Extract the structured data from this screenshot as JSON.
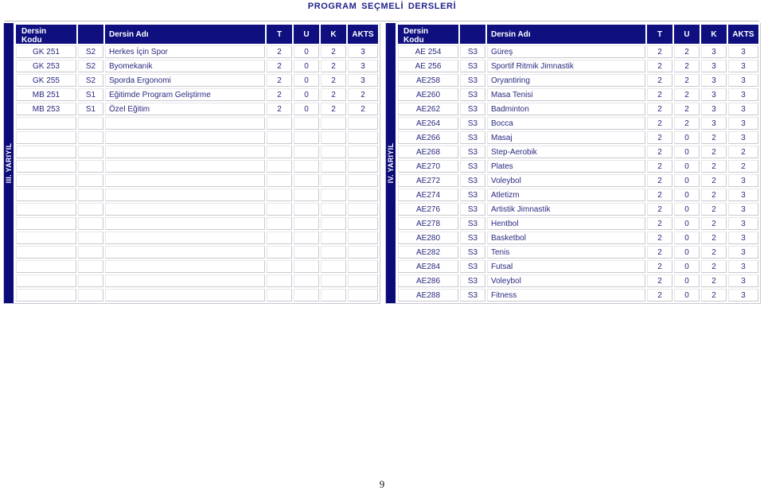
{
  "document": {
    "title": "PROGRAM  SEÇMELİ  DERSLERİ",
    "page_number": "9",
    "accent_color": "#0f0f80",
    "text_color": "#2a2a80"
  },
  "columns": {
    "code_line1": "Dersin",
    "code_line2": "Kodu",
    "group": "",
    "name": "Dersin Adı",
    "t": "T",
    "u": "U",
    "k": "K",
    "akts": "AKTS"
  },
  "tables": [
    {
      "id": "left",
      "semester_label": "III. YARIYIL",
      "total_rows": 18,
      "rows": [
        {
          "code": "GK 251",
          "group": "S2",
          "name": "Herkes İçin  Spor",
          "t": "2",
          "u": "0",
          "k": "2",
          "akts": "3"
        },
        {
          "code": "GK 253",
          "group": "S2",
          "name": "Byomekanik",
          "t": "2",
          "u": "0",
          "k": "2",
          "akts": "3"
        },
        {
          "code": "GK 255",
          "group": "S2",
          "name": "Sporda Ergonomi",
          "t": "2",
          "u": "0",
          "k": "2",
          "akts": "3"
        },
        {
          "code": "MB 251",
          "group": "S1",
          "name": "Eğitimde Program Geliştirme",
          "t": "2",
          "u": "0",
          "k": "2",
          "akts": "2"
        },
        {
          "code": "MB 253",
          "group": "S1",
          "name": "Özel Eğitim",
          "t": "2",
          "u": "0",
          "k": "2",
          "akts": "2"
        },
        {
          "code": "",
          "group": "",
          "name": "",
          "t": "",
          "u": "",
          "k": "",
          "akts": ""
        },
        {
          "code": "",
          "group": "",
          "name": "",
          "t": "",
          "u": "",
          "k": "",
          "akts": ""
        },
        {
          "code": "",
          "group": "",
          "name": "",
          "t": "",
          "u": "",
          "k": "",
          "akts": ""
        },
        {
          "code": "",
          "group": "",
          "name": "",
          "t": "",
          "u": "",
          "k": "",
          "akts": ""
        },
        {
          "code": "",
          "group": "",
          "name": "",
          "t": "",
          "u": "",
          "k": "",
          "akts": ""
        },
        {
          "code": "",
          "group": "",
          "name": "",
          "t": "",
          "u": "",
          "k": "",
          "akts": ""
        },
        {
          "code": "",
          "group": "",
          "name": "",
          "t": "",
          "u": "",
          "k": "",
          "akts": ""
        },
        {
          "code": "",
          "group": "",
          "name": "",
          "t": "",
          "u": "",
          "k": "",
          "akts": ""
        },
        {
          "code": "",
          "group": "",
          "name": "",
          "t": "",
          "u": "",
          "k": "",
          "akts": ""
        },
        {
          "code": "",
          "group": "",
          "name": "",
          "t": "",
          "u": "",
          "k": "",
          "akts": ""
        },
        {
          "code": "",
          "group": "",
          "name": "",
          "t": "",
          "u": "",
          "k": "",
          "akts": ""
        },
        {
          "code": "",
          "group": "",
          "name": "",
          "t": "",
          "u": "",
          "k": "",
          "akts": ""
        },
        {
          "code": "",
          "group": "",
          "name": "",
          "t": "",
          "u": "",
          "k": "",
          "akts": ""
        }
      ]
    },
    {
      "id": "right",
      "semester_label": "IV. YARIYIL",
      "total_rows": 18,
      "rows": [
        {
          "code": "AE 254",
          "group": "S3",
          "name": "Güreş",
          "t": "2",
          "u": "2",
          "k": "3",
          "akts": "3"
        },
        {
          "code": "AE 256",
          "group": "S3",
          "name": "Sportif Ritmik Jimnastik",
          "t": "2",
          "u": "2",
          "k": "3",
          "akts": "3"
        },
        {
          "code": "AE258",
          "group": "S3",
          "name": "Oryantiring",
          "t": "2",
          "u": "2",
          "k": "3",
          "akts": "3"
        },
        {
          "code": "AE260",
          "group": "S3",
          "name": "Masa Tenisi",
          "t": "2",
          "u": "2",
          "k": "3",
          "akts": "3"
        },
        {
          "code": "AE262",
          "group": "S3",
          "name": "Badminton",
          "t": "2",
          "u": "2",
          "k": "3",
          "akts": "3"
        },
        {
          "code": "AE264",
          "group": "S3",
          "name": "Bocca",
          "t": "2",
          "u": "2",
          "k": "3",
          "akts": "3"
        },
        {
          "code": "AE266",
          "group": "S3",
          "name": "Masaj",
          "t": "2",
          "u": "0",
          "k": "2",
          "akts": "3"
        },
        {
          "code": "AE268",
          "group": "S3",
          "name": "Step-Aerobik",
          "t": "2",
          "u": "0",
          "k": "2",
          "akts": "2"
        },
        {
          "code": "AE270",
          "group": "S3",
          "name": "Plates",
          "t": "2",
          "u": "0",
          "k": "2",
          "akts": "2"
        },
        {
          "code": "AE272",
          "group": "S3",
          "name": "Voleybol",
          "t": "2",
          "u": "0",
          "k": "2",
          "akts": "3"
        },
        {
          "code": "AE274",
          "group": "S3",
          "name": "Atletizm",
          "t": "2",
          "u": "0",
          "k": "2",
          "akts": "3"
        },
        {
          "code": "AE276",
          "group": "S3",
          "name": "Artistik Jimnastik",
          "t": "2",
          "u": "0",
          "k": "2",
          "akts": "3"
        },
        {
          "code": "AE278",
          "group": "S3",
          "name": "Hentbol",
          "t": "2",
          "u": "0",
          "k": "2",
          "akts": "3"
        },
        {
          "code": "AE280",
          "group": "S3",
          "name": "Basketbol",
          "t": "2",
          "u": "0",
          "k": "2",
          "akts": "3"
        },
        {
          "code": "AE282",
          "group": "S3",
          "name": "Tenis",
          "t": "2",
          "u": "0",
          "k": "2",
          "akts": "3"
        },
        {
          "code": "AE284",
          "group": "S3",
          "name": "Futsal",
          "t": "2",
          "u": "0",
          "k": "2",
          "akts": "3"
        },
        {
          "code": "AE286",
          "group": "S3",
          "name": "Voleybol",
          "t": "2",
          "u": "0",
          "k": "2",
          "akts": "3"
        },
        {
          "code": "AE288",
          "group": "S3",
          "name": "Fitness",
          "t": "2",
          "u": "0",
          "k": "2",
          "akts": "3"
        }
      ]
    }
  ]
}
